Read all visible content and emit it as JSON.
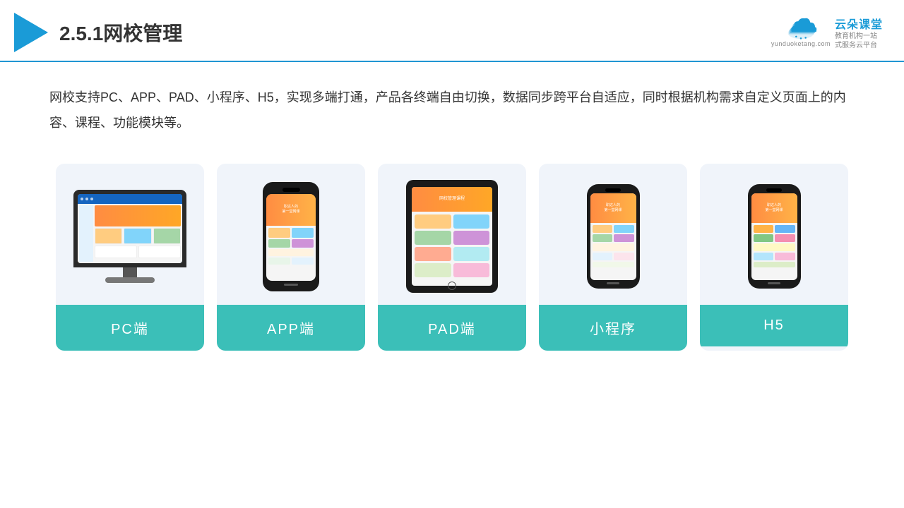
{
  "header": {
    "title": "2.5.1网校管理",
    "brand": {
      "name": "云朵课堂",
      "url": "yunduoketang.com",
      "slogan_line1": "教育机构一站",
      "slogan_line2": "式服务云平台"
    }
  },
  "description": {
    "text": "网校支持PC、APP、PAD、小程序、H5，实现多端打通，产品各终端自由切换，数据同步跨平台自适应，同时根据机构需求自定义页面上的内容、课程、功能模块等。"
  },
  "cards": [
    {
      "id": "pc",
      "label": "PC端"
    },
    {
      "id": "app",
      "label": "APP端"
    },
    {
      "id": "pad",
      "label": "PAD端"
    },
    {
      "id": "miniprogram",
      "label": "小程序"
    },
    {
      "id": "h5",
      "label": "H5"
    }
  ],
  "colors": {
    "accent": "#1a9bd7",
    "card_bg": "#eef2f8",
    "card_label_bg": "#3bbfb8",
    "divider": "#2196d3"
  }
}
